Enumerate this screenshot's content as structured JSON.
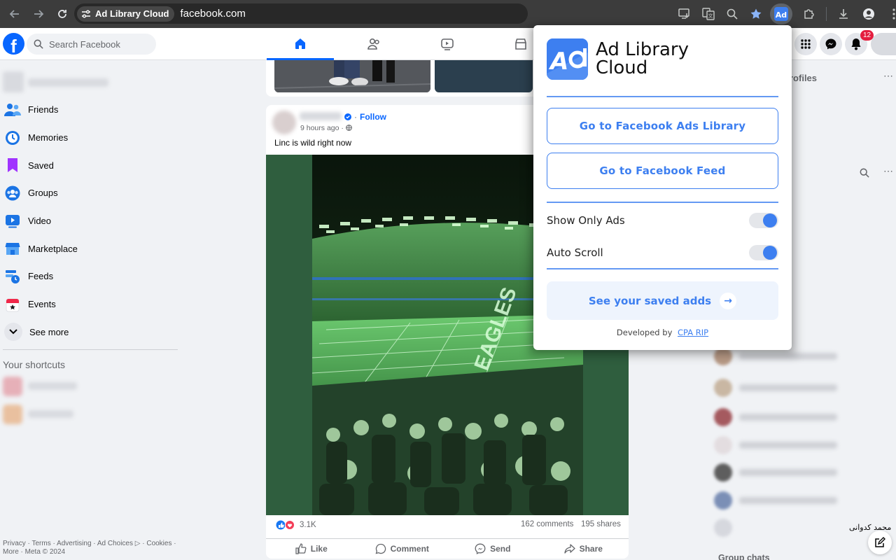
{
  "browser": {
    "site_chip": "Ad Library Cloud",
    "url": "facebook.com"
  },
  "fb": {
    "search_placeholder": "Search Facebook",
    "notification_count": "12",
    "left_nav": [
      {
        "label": "Friends",
        "icon": "friends-icon"
      },
      {
        "label": "Memories",
        "icon": "memories-icon"
      },
      {
        "label": "Saved",
        "icon": "saved-icon"
      },
      {
        "label": "Groups",
        "icon": "groups-icon"
      },
      {
        "label": "Video",
        "icon": "video-icon"
      },
      {
        "label": "Marketplace",
        "icon": "marketplace-icon"
      },
      {
        "label": "Feeds",
        "icon": "feeds-icon"
      },
      {
        "label": "Events",
        "icon": "events-icon"
      },
      {
        "label": "See more",
        "icon": "chevron-down-icon"
      }
    ],
    "shortcuts_title": "Your shortcuts",
    "footer_line1": "Privacy · Terms · Advertising · Ad Choices ▷ · Cookies ·",
    "footer_line2": "More · Meta © 2024",
    "post": {
      "follow": "Follow",
      "time": "9 hours ago ·",
      "text": "Linc is wild right now",
      "reactions": "3.1K",
      "comments": "162 comments",
      "shares": "195 shares",
      "actions": {
        "like": "Like",
        "comment": "Comment",
        "send": "Send",
        "share": "Share"
      }
    },
    "right": {
      "profiles_fragment": "rofiles",
      "contact_name_rtl": "محمد کدوانی",
      "group_chats": "Group chats"
    }
  },
  "extension": {
    "title_line1": "Ad Library",
    "title_line2": "Cloud",
    "btn_ads_library": "Go to Facebook Ads Library",
    "btn_feed": "Go to Facebook Feed",
    "toggle_show_ads": {
      "label": "Show Only Ads",
      "on": true
    },
    "toggle_auto_scroll": {
      "label": "Auto Scroll",
      "on": true
    },
    "saved_ads": "See your saved adds",
    "developed_by": "Developed by",
    "developer": "CPA RIP",
    "accent": "#3d7ff0"
  }
}
